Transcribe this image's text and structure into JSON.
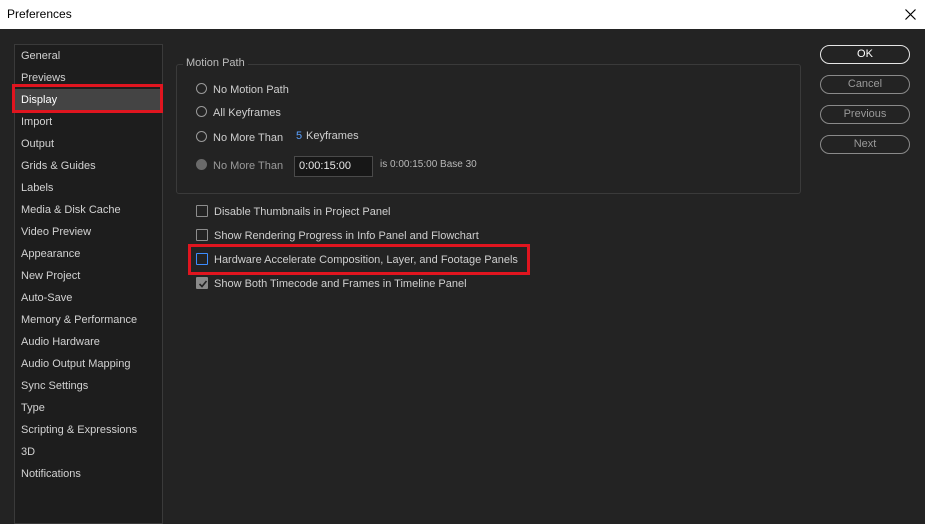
{
  "window": {
    "title": "Preferences"
  },
  "sidebar": {
    "items": [
      {
        "label": "General"
      },
      {
        "label": "Previews"
      },
      {
        "label": "Display",
        "selected": true
      },
      {
        "label": "Import"
      },
      {
        "label": "Output"
      },
      {
        "label": "Grids & Guides"
      },
      {
        "label": "Labels"
      },
      {
        "label": "Media & Disk Cache"
      },
      {
        "label": "Video Preview"
      },
      {
        "label": "Appearance"
      },
      {
        "label": "New Project"
      },
      {
        "label": "Auto-Save"
      },
      {
        "label": "Memory & Performance"
      },
      {
        "label": "Audio Hardware"
      },
      {
        "label": "Audio Output Mapping"
      },
      {
        "label": "Sync Settings"
      },
      {
        "label": "Type"
      },
      {
        "label": "Scripting & Expressions"
      },
      {
        "label": "3D"
      },
      {
        "label": "Notifications"
      }
    ]
  },
  "motion_path": {
    "group_label": "Motion Path",
    "options": [
      {
        "label": "No Motion Path",
        "enabled": true
      },
      {
        "label": "All Keyframes",
        "enabled": true
      },
      {
        "label": "No More Than",
        "enabled": true
      },
      {
        "label": "No More Than",
        "enabled": false
      }
    ],
    "keyframes_value": "5",
    "keyframes_suffix": "Keyframes",
    "timecode_value": "0:00:15:00",
    "timecode_note": "is 0:00:15:00  Base 30"
  },
  "checkboxes": [
    {
      "label": "Disable Thumbnails in Project Panel",
      "checked": false
    },
    {
      "label": "Show Rendering Progress in Info Panel and Flowchart",
      "checked": false
    },
    {
      "label": "Hardware Accelerate Composition, Layer, and Footage Panels",
      "checked": false,
      "focused": true
    },
    {
      "label": "Show Both Timecode and Frames in Timeline Panel",
      "checked": true
    }
  ],
  "buttons": {
    "ok": "OK",
    "cancel": "Cancel",
    "previous": "Previous",
    "next": "Next"
  },
  "colors": {
    "highlight": "#e0151f",
    "accent_value": "#5aa0ff",
    "focus": "#3c8cff"
  }
}
